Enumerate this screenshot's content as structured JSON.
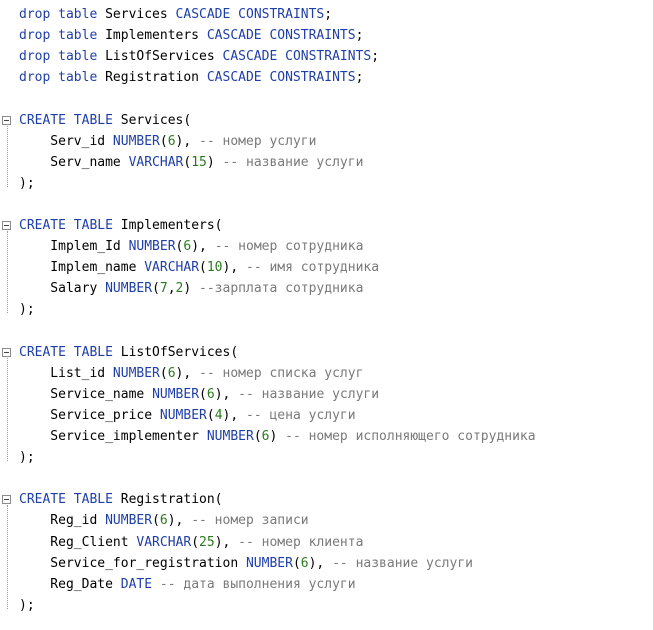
{
  "lines": [
    [
      {
        "t": "drop table ",
        "c": "kw"
      },
      {
        "t": "Services ",
        "c": ""
      },
      {
        "t": "CASCADE CONSTRAINTS",
        "c": "kw"
      },
      {
        "t": ";",
        "c": ""
      }
    ],
    [
      {
        "t": "drop table ",
        "c": "kw"
      },
      {
        "t": "Implementers ",
        "c": ""
      },
      {
        "t": "CASCADE CONSTRAINTS",
        "c": "kw"
      },
      {
        "t": ";",
        "c": ""
      }
    ],
    [
      {
        "t": "drop table ",
        "c": "kw"
      },
      {
        "t": "ListOfServices ",
        "c": ""
      },
      {
        "t": "CASCADE CONSTRAINTS",
        "c": "kw"
      },
      {
        "t": ";",
        "c": ""
      }
    ],
    [
      {
        "t": "drop table ",
        "c": "kw"
      },
      {
        "t": "Registration ",
        "c": ""
      },
      {
        "t": "CASCADE CONSTRAINTS",
        "c": "kw"
      },
      {
        "t": ";",
        "c": ""
      }
    ],
    [],
    [
      {
        "t": "CREATE TABLE ",
        "c": "kw"
      },
      {
        "t": "Services(",
        "c": ""
      }
    ],
    [
      {
        "t": "    Serv_id ",
        "c": ""
      },
      {
        "t": "NUMBER",
        "c": "kw"
      },
      {
        "t": "(",
        "c": ""
      },
      {
        "t": "6",
        "c": "num"
      },
      {
        "t": "), ",
        "c": ""
      },
      {
        "t": "-- номер услуги",
        "c": "cm"
      }
    ],
    [
      {
        "t": "    Serv_name ",
        "c": ""
      },
      {
        "t": "VARCHAR",
        "c": "kw"
      },
      {
        "t": "(",
        "c": ""
      },
      {
        "t": "15",
        "c": "num"
      },
      {
        "t": ") ",
        "c": ""
      },
      {
        "t": "-- название услуги",
        "c": "cm"
      }
    ],
    [
      {
        "t": ");",
        "c": ""
      }
    ],
    [],
    [
      {
        "t": "CREATE TABLE ",
        "c": "kw"
      },
      {
        "t": "Implementers(",
        "c": ""
      }
    ],
    [
      {
        "t": "    Implem_Id ",
        "c": ""
      },
      {
        "t": "NUMBER",
        "c": "kw"
      },
      {
        "t": "(",
        "c": ""
      },
      {
        "t": "6",
        "c": "num"
      },
      {
        "t": "), ",
        "c": ""
      },
      {
        "t": "-- номер сотрудника",
        "c": "cm"
      }
    ],
    [
      {
        "t": "    Implem_name ",
        "c": ""
      },
      {
        "t": "VARCHAR",
        "c": "kw"
      },
      {
        "t": "(",
        "c": ""
      },
      {
        "t": "10",
        "c": "num"
      },
      {
        "t": "), ",
        "c": ""
      },
      {
        "t": "-- имя сотрудника",
        "c": "cm"
      }
    ],
    [
      {
        "t": "    Salary ",
        "c": ""
      },
      {
        "t": "NUMBER",
        "c": "kw"
      },
      {
        "t": "(",
        "c": ""
      },
      {
        "t": "7",
        "c": "num"
      },
      {
        "t": ",",
        "c": ""
      },
      {
        "t": "2",
        "c": "num"
      },
      {
        "t": ") ",
        "c": ""
      },
      {
        "t": "--зарплата сотрудника",
        "c": "cm"
      }
    ],
    [
      {
        "t": ");",
        "c": ""
      }
    ],
    [],
    [
      {
        "t": "CREATE TABLE ",
        "c": "kw"
      },
      {
        "t": "ListOfServices(",
        "c": ""
      }
    ],
    [
      {
        "t": "    List_id ",
        "c": ""
      },
      {
        "t": "NUMBER",
        "c": "kw"
      },
      {
        "t": "(",
        "c": ""
      },
      {
        "t": "6",
        "c": "num"
      },
      {
        "t": "), ",
        "c": ""
      },
      {
        "t": "-- номер списка услуг",
        "c": "cm"
      }
    ],
    [
      {
        "t": "    Service_name ",
        "c": ""
      },
      {
        "t": "NUMBER",
        "c": "kw"
      },
      {
        "t": "(",
        "c": ""
      },
      {
        "t": "6",
        "c": "num"
      },
      {
        "t": "), ",
        "c": ""
      },
      {
        "t": "-- название услуги",
        "c": "cm"
      }
    ],
    [
      {
        "t": "    Service_price ",
        "c": ""
      },
      {
        "t": "NUMBER",
        "c": "kw"
      },
      {
        "t": "(",
        "c": ""
      },
      {
        "t": "4",
        "c": "num"
      },
      {
        "t": "), ",
        "c": ""
      },
      {
        "t": "-- цена услуги",
        "c": "cm"
      }
    ],
    [
      {
        "t": "    Service_implementer ",
        "c": ""
      },
      {
        "t": "NUMBER",
        "c": "kw"
      },
      {
        "t": "(",
        "c": ""
      },
      {
        "t": "6",
        "c": "num"
      },
      {
        "t": ") ",
        "c": ""
      },
      {
        "t": "-- номер исполняющего сотрудника",
        "c": "cm"
      }
    ],
    [
      {
        "t": ");",
        "c": ""
      }
    ],
    [],
    [
      {
        "t": "CREATE TABLE ",
        "c": "kw"
      },
      {
        "t": "Registration(",
        "c": ""
      }
    ],
    [
      {
        "t": "    Reg_id ",
        "c": ""
      },
      {
        "t": "NUMBER",
        "c": "kw"
      },
      {
        "t": "(",
        "c": ""
      },
      {
        "t": "6",
        "c": "num"
      },
      {
        "t": "), ",
        "c": ""
      },
      {
        "t": "-- номер записи",
        "c": "cm"
      }
    ],
    [
      {
        "t": "    Reg_Client ",
        "c": ""
      },
      {
        "t": "VARCHAR",
        "c": "kw"
      },
      {
        "t": "(",
        "c": ""
      },
      {
        "t": "25",
        "c": "num"
      },
      {
        "t": "), ",
        "c": ""
      },
      {
        "t": "-- номер клиента",
        "c": "cm"
      }
    ],
    [
      {
        "t": "    Service_for_registration ",
        "c": ""
      },
      {
        "t": "NUMBER",
        "c": "kw"
      },
      {
        "t": "(",
        "c": ""
      },
      {
        "t": "6",
        "c": "num"
      },
      {
        "t": "), ",
        "c": ""
      },
      {
        "t": "-- название услуги",
        "c": "cm"
      }
    ],
    [
      {
        "t": "    Reg_Date ",
        "c": ""
      },
      {
        "t": "DATE ",
        "c": "kw"
      },
      {
        "t": "-- дата выполнения услуги",
        "c": "cm"
      }
    ],
    [
      {
        "t": ");",
        "c": ""
      }
    ]
  ],
  "colors": {
    "keyword": "#1f3fa8",
    "number": "#2b7a1f",
    "comment": "#7a7a7a",
    "text": "#000000"
  },
  "icons": {
    "fold": "fold-collapse-icon"
  }
}
